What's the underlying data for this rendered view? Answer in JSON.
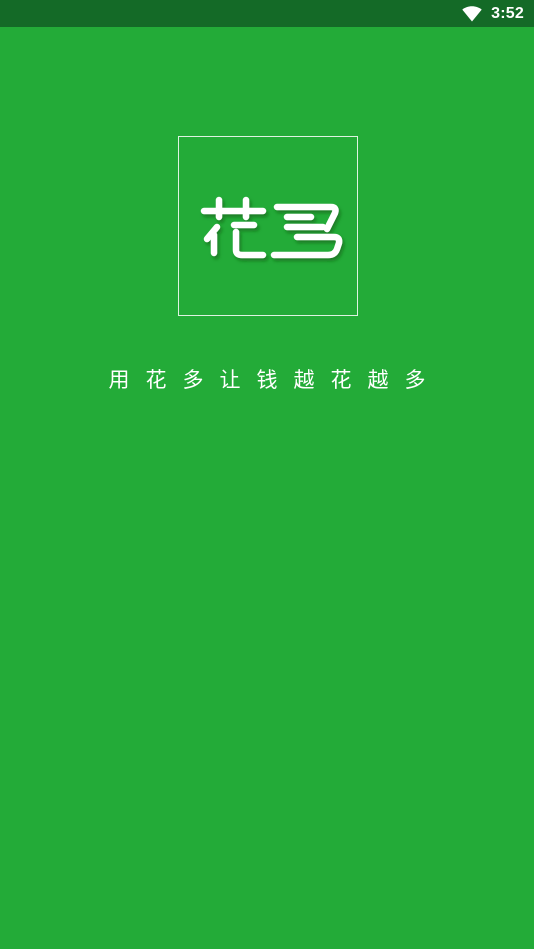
{
  "status_bar": {
    "time": "3:52",
    "wifi_icon": "wifi-full-icon"
  },
  "splash": {
    "logo_text": "花多",
    "logo_icon": "huaduo-logo",
    "slogan": "用花多让钱越花越多"
  },
  "colors": {
    "background": "#23ab38",
    "status_bar": "#146a27",
    "text": "#ffffff"
  }
}
